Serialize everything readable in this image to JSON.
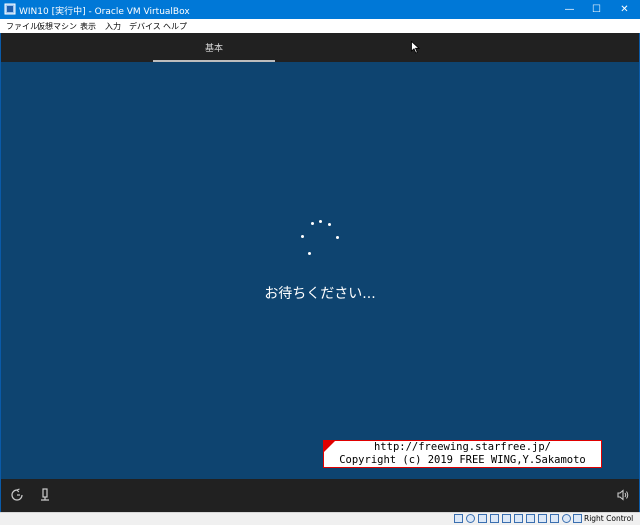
{
  "window": {
    "title": "WIN10 [実行中] - Oracle VM VirtualBox",
    "minimize_glyph": "—",
    "maximize_glyph": "☐",
    "close_glyph": "✕"
  },
  "menu": {
    "items": [
      "ファイル",
      "仮想マシン",
      "表示",
      "入力",
      "デバイス",
      "ヘルプ"
    ]
  },
  "setup": {
    "tab_label": "基本",
    "waiting_text": "お待ちください..."
  },
  "watermark": {
    "line1": "http://freewing.starfree.jp/",
    "line2": "Copyright (c) 2019 FREE WING,Y.Sakamoto"
  },
  "statusbar": {
    "host_key": "Right Control",
    "icons": [
      "hard-disk-icon",
      "optical-drive-icon",
      "audio-icon",
      "network-icon",
      "usb-icon",
      "shared-folders-icon",
      "display-icon",
      "video-capture-icon",
      "cpu-icon",
      "mouse-integration-icon",
      "keyboard-icon"
    ]
  },
  "colors": {
    "titlebar": "#0078d7",
    "setup_background": "#0e4470",
    "setup_bars": "#212121",
    "watermark_border": "#e00000"
  }
}
